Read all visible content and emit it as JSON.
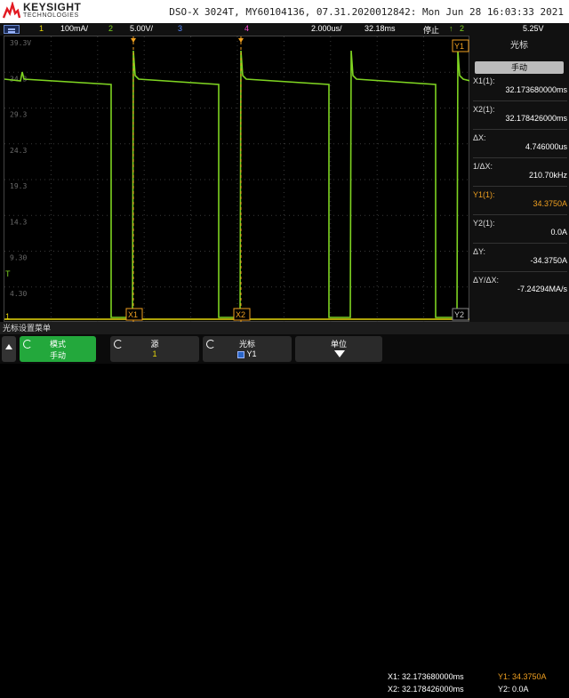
{
  "header": {
    "brand": "KEYSIGHT",
    "brand_sub": "TECHNOLOGIES",
    "title": "DSO-X 3024T, MY60104136, 07.31.2020012842: Mon Jun 28 16:03:33 2021"
  },
  "channel_bar": {
    "ch1_num": "1",
    "ch1_scale": "100mA/",
    "ch2_num": "2",
    "ch2_scale": "5.00V/",
    "ch3_num": "3",
    "ch4_num": "4",
    "timebase": "2.000us/",
    "delay": "32.18ms",
    "run_state": "停止",
    "trig_icon": "trigger-edge-icon",
    "trig_ch": "2",
    "trig_level": "5.25V"
  },
  "grid": {
    "y_labels": [
      "39.3V",
      "34.3",
      "29.3",
      "24.3",
      "19.3",
      "14.3",
      "9.30",
      "4.30"
    ],
    "cursor_x1_label": "X1",
    "cursor_x2_label": "X2",
    "cursor_y1_label": "Y1",
    "cursor_y2_label": "Y2",
    "ground_marker": "1",
    "trig_marker": "T",
    "trace_color": "#7ed321",
    "ch1_color": "#e8d80a",
    "cursor_color": "#f0a020"
  },
  "right_panel": {
    "title": "光标",
    "mode_label": "模式",
    "mode": "手动",
    "x1_label": "X1(1):",
    "x1_value": "32.173680000ms",
    "x2_label": "X2(1):",
    "x2_value": "32.178426000ms",
    "dx_label": "ΔX:",
    "dx_value": "4.746000us",
    "inv_dx_label": "1/ΔX:",
    "inv_dx_value": "210.70kHz",
    "y1_label": "Y1(1):",
    "y1_value": "34.3750A",
    "y2_label": "Y2(1):",
    "y2_value": "0.0A",
    "dy_label": "ΔY:",
    "dy_value": "-34.3750A",
    "dydx_label": "ΔY/ΔX:",
    "dydx_value": "-7.24294MA/s"
  },
  "bottom": {
    "menu_title": "光标设置菜单",
    "soft1_title": "模式",
    "soft1_value": "手动",
    "soft2_title": "源",
    "soft2_value": "1",
    "soft3_title": "光标",
    "soft3_value": "Y1",
    "soft4_title": "单位",
    "readout_x1": "X1: 32.173680000ms",
    "readout_x2": "X2: 32.178426000ms",
    "readout_y1": "Y1: 34.3750A",
    "readout_y2": "Y2: 0.0A"
  }
}
